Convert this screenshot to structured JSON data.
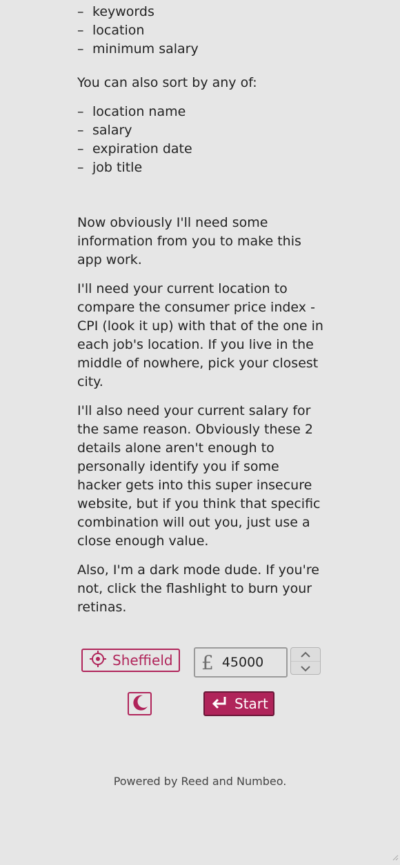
{
  "filters": {
    "items": [
      "keywords",
      "location",
      "minimum salary"
    ]
  },
  "sort": {
    "intro": "You can also sort by any of:",
    "items": [
      "location name",
      "salary",
      "expiration date",
      "job title"
    ]
  },
  "explanation": {
    "p1": "Now obviously I'll need some information from you to make this app work.",
    "p2": "I'll need your current location to compare the consumer price index - CPI (look it up) with that of the one in each job's location. If you live in the middle of nowhere, pick your closest city.",
    "p3": "I'll also need your current salary for the same reason. Obviously these 2 details alone aren't enough to personally identify you if some hacker gets into this super insecure website, but if you think that specific combination will out you, just use a close enough value.",
    "p4": "Also, I'm a dark mode dude. If you're not, click the flashlight to burn your retinas."
  },
  "controls": {
    "location_label": "Sheffield",
    "location_icon": "crosshair-icon",
    "currency_symbol": "£",
    "salary_value": "45000",
    "theme_icon": "moon-icon",
    "start_label": "Start",
    "start_icon": "return-arrow-icon"
  },
  "footer": {
    "text": "Powered by Reed and Numbeo."
  },
  "colors": {
    "accent": "#b0245a",
    "background": "#e6e6e6"
  }
}
